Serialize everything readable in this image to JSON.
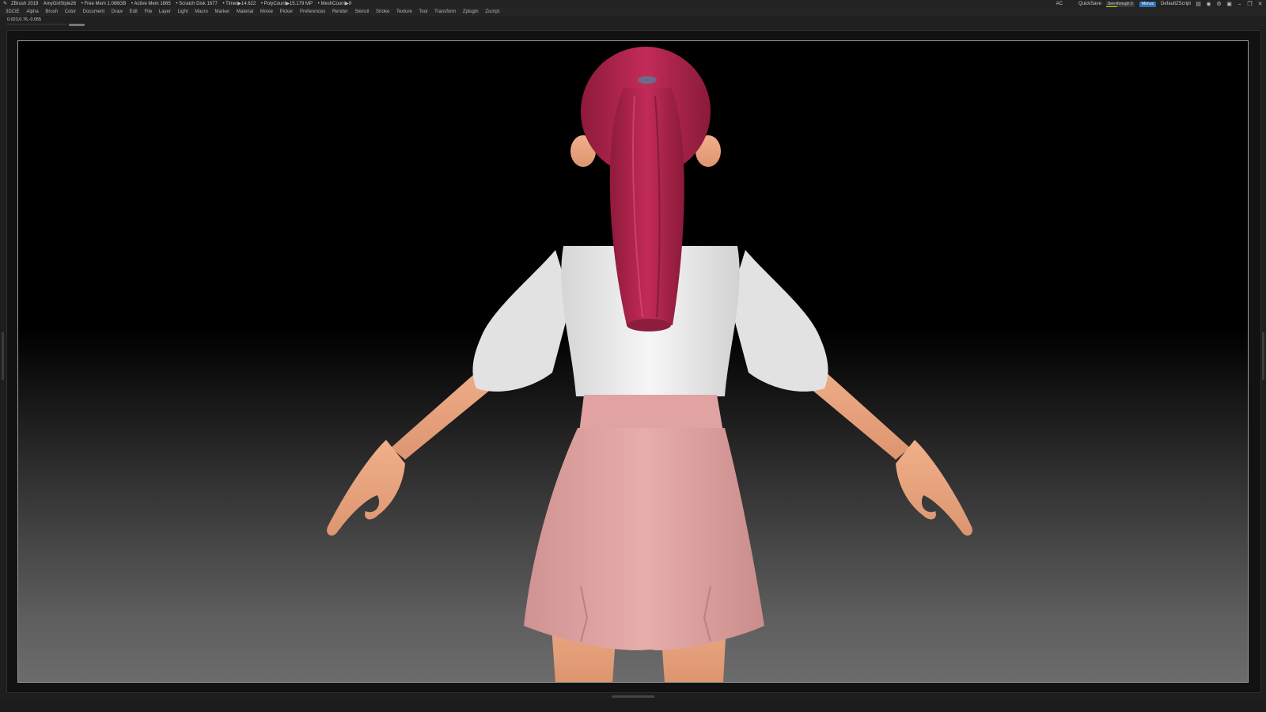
{
  "titlebar": {
    "app_title": "ZBrush 2019",
    "document": "AmyGirlStyle26",
    "free_mem": "• Free Mem 1.086GB",
    "active_mem": "• Active Mem 1865",
    "scratch_disk": "• Scratch Disk 1677",
    "timer": "• Timer▶14.622",
    "polycount": "• PolyCount▶15.179 MP",
    "meshcount": "• MeshCount▶9",
    "ac": "AC",
    "quicksave": "QuickSave",
    "see_through": "See-through  0",
    "menus_button": "Menus",
    "zscript": "DefaultZScript"
  },
  "menubar": {
    "items": [
      "3DCIE",
      "Alpha",
      "Brush",
      "Color",
      "Document",
      "Draw",
      "Edit",
      "File",
      "Layer",
      "Light",
      "Macro",
      "Marker",
      "Material",
      "Movie",
      "Picker",
      "Preferences",
      "Render",
      "Stencil",
      "Stroke",
      "Texture",
      "Tool",
      "Transform",
      "Zplugin",
      "Zscript"
    ]
  },
  "infobar": {
    "coordinates": "0.023,0.76,-0.055"
  },
  "colors": {
    "hair": "#b2244f",
    "skin": "#e8a57e",
    "shirt": "#f0f0f0",
    "skirt": "#e1a5a5",
    "accent": "#2f6fb7"
  },
  "icons": [
    "dock-icon",
    "camera-icon",
    "gear-icon",
    "lock-icon",
    "minimize-icon",
    "restore-icon",
    "close-icon"
  ]
}
